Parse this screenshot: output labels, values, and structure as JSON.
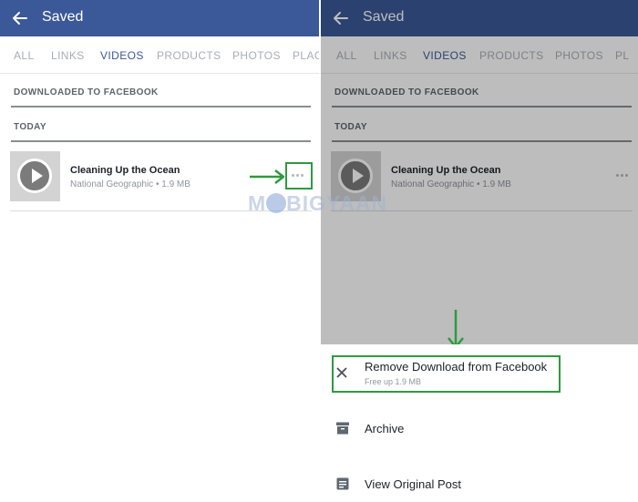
{
  "left": {
    "header": {
      "title": "Saved"
    },
    "tabs": [
      {
        "label": "ALL",
        "active": false
      },
      {
        "label": "LINKS",
        "active": false
      },
      {
        "label": "VIDEOS",
        "active": true
      },
      {
        "label": "PRODUCTS",
        "active": false
      },
      {
        "label": "PHOTOS",
        "active": false
      },
      {
        "label": "PLAC",
        "active": false
      }
    ],
    "sections": {
      "downloaded": "DOWNLOADED TO FACEBOOK",
      "today": "TODAY"
    },
    "item": {
      "title": "Cleaning Up the Ocean",
      "meta": "National Geographic • 1.9 MB"
    }
  },
  "right": {
    "header": {
      "title": "Saved"
    },
    "tabs": [
      {
        "label": "ALL",
        "active": false
      },
      {
        "label": "LINKS",
        "active": false
      },
      {
        "label": "VIDEOS",
        "active": true
      },
      {
        "label": "PRODUCTS",
        "active": false
      },
      {
        "label": "PHOTOS",
        "active": false
      },
      {
        "label": "PL",
        "active": false
      }
    ],
    "sections": {
      "downloaded": "DOWNLOADED TO FACEBOOK",
      "today": "TODAY"
    },
    "item": {
      "title": "Cleaning Up the Ocean",
      "meta": "National Geographic • 1.9 MB"
    },
    "sheet": {
      "remove": {
        "label": "Remove Download from Facebook",
        "sub": "Free up 1.9 MB"
      },
      "archive": {
        "label": "Archive"
      },
      "view": {
        "label": "View Original Post"
      }
    }
  },
  "watermark": {
    "pre": "M",
    "post": "BIGYAAN"
  },
  "icons": {
    "back": "arrow-left-icon",
    "more": "more-horizontal-icon",
    "play": "play-icon",
    "close": "close-icon",
    "archive": "archive-box-icon",
    "post": "document-icon"
  },
  "colors": {
    "header": "#3b5998",
    "highlight": "#2e9a3e",
    "active_tab": "#3b5998"
  }
}
